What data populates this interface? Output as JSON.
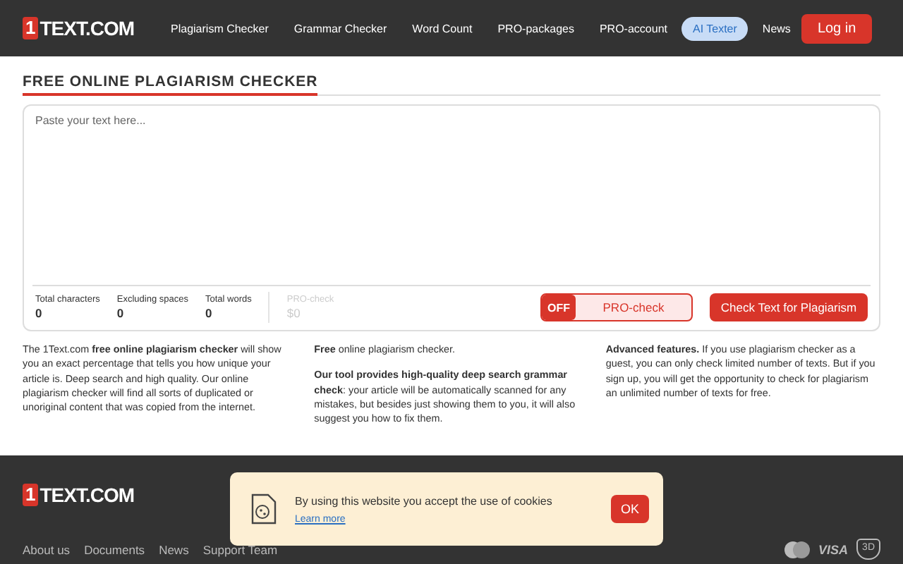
{
  "header": {
    "logo": {
      "mark": "1",
      "name": "TEXT.COM"
    },
    "nav": [
      {
        "label": "Plagiarism Checker",
        "selected": false
      },
      {
        "label": "Grammar Checker",
        "selected": false
      },
      {
        "label": "Word Count",
        "selected": false
      },
      {
        "label": "PRO-packages",
        "selected": false
      },
      {
        "label": "PRO-account",
        "selected": false
      },
      {
        "label": "AI Texter",
        "selected": true
      },
      {
        "label": "News",
        "selected": false
      }
    ],
    "login": "Log in"
  },
  "title": "FREE ONLINE PLAGIARISM CHECKER",
  "editor": {
    "placeholder": "Paste your text here...",
    "stats": [
      {
        "label": "Total characters",
        "value": "0",
        "disabled": false
      },
      {
        "label": "Excluding spaces",
        "value": "0",
        "disabled": false
      },
      {
        "label": "Total words",
        "value": "0",
        "disabled": false
      },
      {
        "label": "PRO-check",
        "value": "$0",
        "disabled": true
      }
    ],
    "pro_toggle": {
      "state": "OFF",
      "label": "PRO-check",
      "on": false
    },
    "check_button": "Check Text for Plagiarism"
  },
  "columns": [
    [
      "The 1Text.com **free online plagiarism checker** will show you an exact percentage that tells you how unique your article is. Deep search and high quality. Our online plagiarism checker will find all sorts of duplicated or unoriginal content that was copied from the internet."
    ],
    [
      "**Free** online plagiarism checker.",
      "**Our tool provides high-quality deep search grammar check**: your article will be automatically scanned for any mistakes, but besides just showing them to you, it will also suggest you how to fix them."
    ],
    [
      "**Advanced features.** If you use plagiarism checker as a guest, you can only check limited number of texts. But if you sign up, you will get the opportunity to check for plagiarism an unlimited number of texts for free."
    ]
  ],
  "footer": {
    "logo": {
      "mark": "1",
      "name": "TEXT.COM"
    },
    "links": [
      "About us",
      "Documents",
      "News",
      "Support Team"
    ],
    "payments": {
      "visa": "VISA",
      "secure": "3D"
    }
  },
  "cookie": {
    "text": "By using this website you accept the use of cookies",
    "link": "Learn more",
    "button": "OK"
  }
}
